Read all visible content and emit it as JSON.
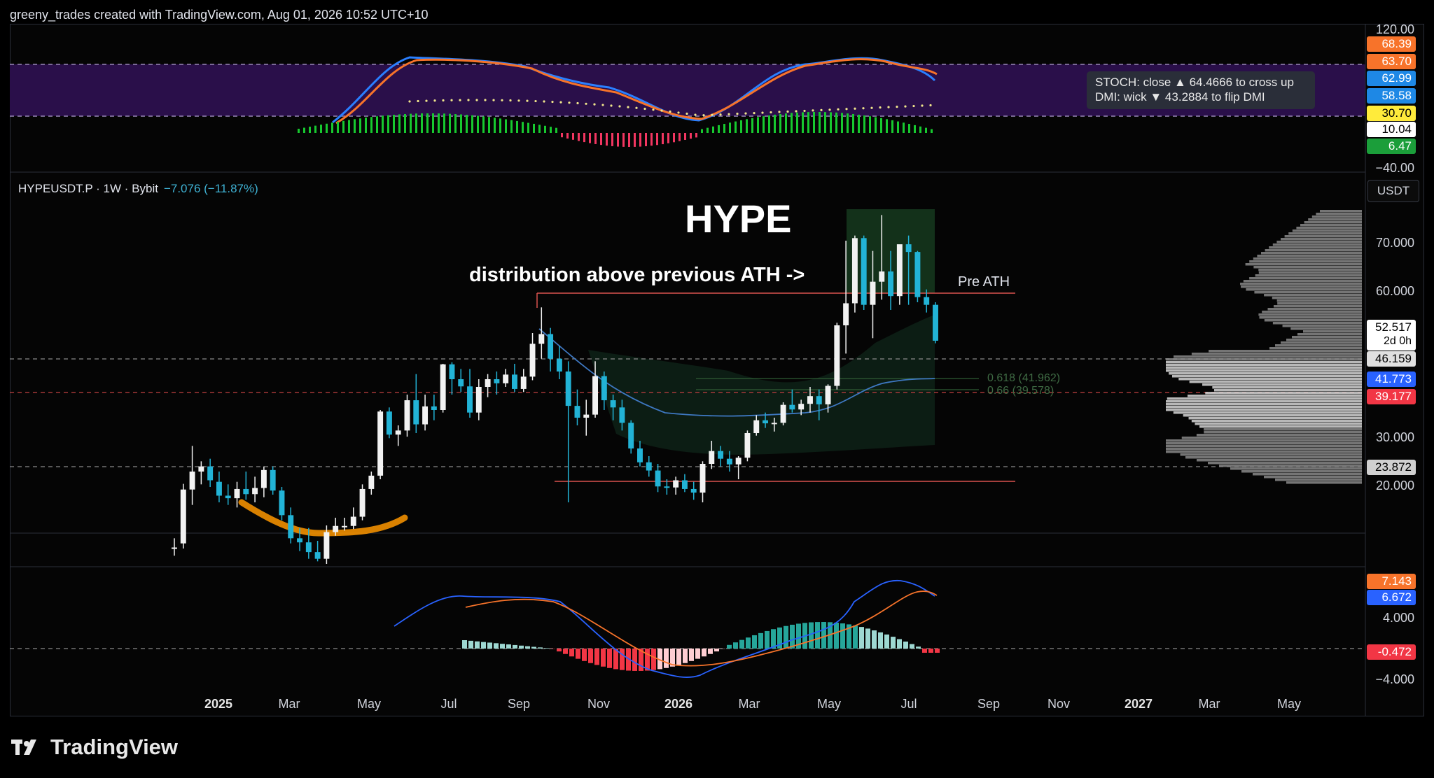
{
  "header": {
    "text": "greeny_trades created with TradingView.com, Aug 01, 2026 10:52 UTC+10"
  },
  "symbol": {
    "name": "HYPEUSDT.P · 1W · Bybit",
    "change": "−7.076 (−11.87%)"
  },
  "currency_button": "USDT",
  "annotations": {
    "title": "HYPE",
    "distribution": "distribution above previous ATH ->",
    "pre_ath": "Pre ATH",
    "fib_618": "0.618 (41.962)",
    "fib_66": "0.66 (39.578)"
  },
  "tooltip": {
    "line1": "STOCH: close ▲ 64.4666 to cross up",
    "line2": "DMI: wick ▼ 43.2884 to flip DMI"
  },
  "stoch_pane": {
    "axis_top": "120.00",
    "axis_bottom": "−40.00",
    "tags": [
      {
        "text": "68.39",
        "bg": "#f7732a",
        "fg": "#fff"
      },
      {
        "text": "63.70",
        "bg": "#f7732a",
        "fg": "#fff"
      },
      {
        "text": "62.99",
        "bg": "#1e88e5",
        "fg": "#fff"
      },
      {
        "text": "58.58",
        "bg": "#1e88e5",
        "fg": "#fff"
      },
      {
        "text": "30.70",
        "bg": "#ffeb3b",
        "fg": "#000"
      },
      {
        "text": "10.04",
        "bg": "#ffffff",
        "fg": "#000"
      },
      {
        "text": "6.47",
        "bg": "#1b9e3a",
        "fg": "#fff"
      }
    ]
  },
  "price_pane": {
    "axis_labels": [
      "70.000",
      "60.000",
      "30.000",
      "20.000"
    ],
    "tags": [
      {
        "text": "52.517",
        "sub": "2d 0h",
        "bg": "#ffffff",
        "fg": "#000"
      },
      {
        "text": "46.159",
        "bg": "#e0e0e0",
        "fg": "#000"
      },
      {
        "text": "41.773",
        "bg": "#2962ff",
        "fg": "#fff"
      },
      {
        "text": "39.177",
        "bg": "#f23645",
        "fg": "#fff"
      },
      {
        "text": "23.872",
        "bg": "#d0d0d0",
        "fg": "#000"
      }
    ]
  },
  "macd_pane": {
    "axis_labels": [
      "4.000",
      "−4.000"
    ],
    "tags": [
      {
        "text": "7.143",
        "bg": "#f7732a",
        "fg": "#fff"
      },
      {
        "text": "6.672",
        "bg": "#2962ff",
        "fg": "#fff"
      },
      {
        "text": "-0.472",
        "bg": "#f23645",
        "fg": "#fff"
      }
    ]
  },
  "time_axis": [
    {
      "label": "2025",
      "year": true
    },
    {
      "label": "Mar"
    },
    {
      "label": "May"
    },
    {
      "label": "Jul"
    },
    {
      "label": "Sep"
    },
    {
      "label": "Nov"
    },
    {
      "label": "2026",
      "year": true
    },
    {
      "label": "Mar"
    },
    {
      "label": "May"
    },
    {
      "label": "Jul"
    },
    {
      "label": "Sep"
    },
    {
      "label": "Nov"
    },
    {
      "label": "2027",
      "year": true
    },
    {
      "label": "Mar"
    },
    {
      "label": "May"
    }
  ],
  "footer": {
    "brand": "TradingView"
  },
  "chart_data": {
    "type": "candlestick",
    "symbol": "HYPEUSDT.P",
    "interval": "1W",
    "exchange": "Bybit",
    "ylim": [
      18,
      78
    ],
    "horizontal_levels": [
      60.0,
      46.159,
      41.962,
      39.578,
      23.872,
      21.0
    ],
    "last_price": 52.517,
    "candles": [
      {
        "o": 12.0,
        "h": 14.0,
        "l": 10.6,
        "c": 12.2
      },
      {
        "o": 13.0,
        "h": 24.6,
        "l": 12.0,
        "c": 23.5
      },
      {
        "o": 23.5,
        "h": 32.0,
        "l": 20.5,
        "c": 27.0
      },
      {
        "o": 27.0,
        "h": 29.0,
        "l": 24.5,
        "c": 28.0
      },
      {
        "o": 28.0,
        "h": 29.5,
        "l": 24.0,
        "c": 25.3
      },
      {
        "o": 25.0,
        "h": 27.0,
        "l": 21.0,
        "c": 22.3
      },
      {
        "o": 22.3,
        "h": 24.5,
        "l": 20.5,
        "c": 21.8
      },
      {
        "o": 21.8,
        "h": 25.0,
        "l": 20.0,
        "c": 23.6
      },
      {
        "o": 23.6,
        "h": 27.0,
        "l": 21.5,
        "c": 22.6
      },
      {
        "o": 22.6,
        "h": 26.0,
        "l": 21.0,
        "c": 23.8
      },
      {
        "o": 23.8,
        "h": 28.0,
        "l": 22.0,
        "c": 27.3
      },
      {
        "o": 27.3,
        "h": 28.0,
        "l": 22.5,
        "c": 23.3
      },
      {
        "o": 23.3,
        "h": 24.0,
        "l": 17.5,
        "c": 18.5
      },
      {
        "o": 18.5,
        "h": 20.0,
        "l": 13.0,
        "c": 14.0
      },
      {
        "o": 14.0,
        "h": 16.0,
        "l": 11.5,
        "c": 13.2
      },
      {
        "o": 13.2,
        "h": 16.0,
        "l": 10.0,
        "c": 11.3
      },
      {
        "o": 11.3,
        "h": 13.5,
        "l": 9.5,
        "c": 10.0
      },
      {
        "o": 10.0,
        "h": 16.5,
        "l": 9.0,
        "c": 15.2
      },
      {
        "o": 15.2,
        "h": 18.0,
        "l": 14.5,
        "c": 16.4
      },
      {
        "o": 16.4,
        "h": 18.0,
        "l": 15.5,
        "c": 16.4
      },
      {
        "o": 16.4,
        "h": 20.0,
        "l": 15.8,
        "c": 18.2
      },
      {
        "o": 18.2,
        "h": 24.5,
        "l": 17.5,
        "c": 23.6
      },
      {
        "o": 23.6,
        "h": 27.0,
        "l": 22.5,
        "c": 26.2
      },
      {
        "o": 26.2,
        "h": 39.0,
        "l": 25.5,
        "c": 38.7
      },
      {
        "o": 38.7,
        "h": 39.5,
        "l": 33.5,
        "c": 34.2
      },
      {
        "o": 34.2,
        "h": 36.0,
        "l": 32.0,
        "c": 35.0
      },
      {
        "o": 35.0,
        "h": 42.0,
        "l": 33.8,
        "c": 40.9
      },
      {
        "o": 40.9,
        "h": 46.0,
        "l": 34.5,
        "c": 36.2
      },
      {
        "o": 36.2,
        "h": 42.0,
        "l": 35.0,
        "c": 39.7
      },
      {
        "o": 39.7,
        "h": 42.0,
        "l": 37.0,
        "c": 39.0
      },
      {
        "o": 39.0,
        "h": 48.0,
        "l": 38.5,
        "c": 47.9
      },
      {
        "o": 47.9,
        "h": 48.3,
        "l": 42.0,
        "c": 45.0
      },
      {
        "o": 45.0,
        "h": 47.0,
        "l": 42.5,
        "c": 43.6
      },
      {
        "o": 43.6,
        "h": 47.0,
        "l": 37.5,
        "c": 38.5
      },
      {
        "o": 38.5,
        "h": 45.0,
        "l": 37.0,
        "c": 43.5
      },
      {
        "o": 43.5,
        "h": 46.0,
        "l": 41.5,
        "c": 45.0
      },
      {
        "o": 45.0,
        "h": 46.5,
        "l": 42.0,
        "c": 44.2
      },
      {
        "o": 44.2,
        "h": 47.0,
        "l": 43.5,
        "c": 45.9
      },
      {
        "o": 45.9,
        "h": 48.0,
        "l": 42.5,
        "c": 43.1
      },
      {
        "o": 43.1,
        "h": 47.0,
        "l": 42.5,
        "c": 45.5
      },
      {
        "o": 45.5,
        "h": 54.0,
        "l": 44.8,
        "c": 51.9
      },
      {
        "o": 51.9,
        "h": 59.0,
        "l": 49.0,
        "c": 53.8
      },
      {
        "o": 53.8,
        "h": 55.0,
        "l": 46.5,
        "c": 49.0
      },
      {
        "o": 49.0,
        "h": 51.5,
        "l": 45.0,
        "c": 46.5
      },
      {
        "o": 46.5,
        "h": 48.5,
        "l": 21.0,
        "c": 39.8
      },
      {
        "o": 39.8,
        "h": 43.0,
        "l": 36.0,
        "c": 37.5
      },
      {
        "o": 37.5,
        "h": 41.0,
        "l": 34.0,
        "c": 38.1
      },
      {
        "o": 38.1,
        "h": 48.5,
        "l": 37.5,
        "c": 45.6
      },
      {
        "o": 45.6,
        "h": 46.5,
        "l": 39.0,
        "c": 40.9
      },
      {
        "o": 40.9,
        "h": 42.0,
        "l": 37.0,
        "c": 39.5
      },
      {
        "o": 39.5,
        "h": 41.0,
        "l": 35.0,
        "c": 36.5
      },
      {
        "o": 36.5,
        "h": 37.0,
        "l": 30.5,
        "c": 31.5
      },
      {
        "o": 31.5,
        "h": 33.0,
        "l": 28.0,
        "c": 28.8
      },
      {
        "o": 28.8,
        "h": 30.0,
        "l": 26.0,
        "c": 27.2
      },
      {
        "o": 27.2,
        "h": 28.5,
        "l": 23.0,
        "c": 24.1
      },
      {
        "o": 24.1,
        "h": 25.5,
        "l": 22.5,
        "c": 23.9
      },
      {
        "o": 23.9,
        "h": 26.0,
        "l": 22.5,
        "c": 25.3
      },
      {
        "o": 25.3,
        "h": 26.5,
        "l": 23.0,
        "c": 23.6
      },
      {
        "o": 23.6,
        "h": 25.0,
        "l": 21.5,
        "c": 22.9
      },
      {
        "o": 22.9,
        "h": 29.0,
        "l": 21.0,
        "c": 28.5
      },
      {
        "o": 28.5,
        "h": 33.0,
        "l": 27.5,
        "c": 31.0
      },
      {
        "o": 31.0,
        "h": 32.0,
        "l": 28.0,
        "c": 29.5
      },
      {
        "o": 29.5,
        "h": 31.0,
        "l": 27.0,
        "c": 28.4
      },
      {
        "o": 28.4,
        "h": 30.0,
        "l": 25.5,
        "c": 29.7
      },
      {
        "o": 29.7,
        "h": 35.0,
        "l": 29.0,
        "c": 34.5
      },
      {
        "o": 34.5,
        "h": 38.0,
        "l": 34.0,
        "c": 37.0
      },
      {
        "o": 37.0,
        "h": 38.5,
        "l": 35.5,
        "c": 36.4
      },
      {
        "o": 36.4,
        "h": 37.5,
        "l": 34.8,
        "c": 36.5
      },
      {
        "o": 36.5,
        "h": 40.5,
        "l": 36.0,
        "c": 40.0
      },
      {
        "o": 40.0,
        "h": 43.0,
        "l": 38.5,
        "c": 39.1
      },
      {
        "o": 39.1,
        "h": 41.0,
        "l": 38.0,
        "c": 40.2
      },
      {
        "o": 40.2,
        "h": 43.5,
        "l": 38.5,
        "c": 41.7
      },
      {
        "o": 41.7,
        "h": 43.0,
        "l": 37.0,
        "c": 40.1
      },
      {
        "o": 40.1,
        "h": 44.0,
        "l": 38.5,
        "c": 43.7
      },
      {
        "o": 43.7,
        "h": 56.0,
        "l": 43.0,
        "c": 55.5
      },
      {
        "o": 55.5,
        "h": 72.0,
        "l": 50.0,
        "c": 59.8
      },
      {
        "o": 59.8,
        "h": 73.0,
        "l": 58.0,
        "c": 72.5
      },
      {
        "o": 72.5,
        "h": 73.0,
        "l": 58.5,
        "c": 59.5
      },
      {
        "o": 59.5,
        "h": 70.0,
        "l": 53.0,
        "c": 64.0
      },
      {
        "o": 64.0,
        "h": 77.0,
        "l": 60.5,
        "c": 66.0
      },
      {
        "o": 66.0,
        "h": 70.0,
        "l": 58.5,
        "c": 61.2
      },
      {
        "o": 61.2,
        "h": 70.0,
        "l": 59.5,
        "c": 71.3
      },
      {
        "o": 71.3,
        "h": 73.0,
        "l": 59.5,
        "c": 69.8
      },
      {
        "o": 69.8,
        "h": 70.0,
        "l": 60.0,
        "c": 61.0
      },
      {
        "o": 61.0,
        "h": 62.5,
        "l": 58.0,
        "c": 59.5
      },
      {
        "o": 59.5,
        "h": 60.0,
        "l": 52.0,
        "c": 52.5
      }
    ]
  }
}
